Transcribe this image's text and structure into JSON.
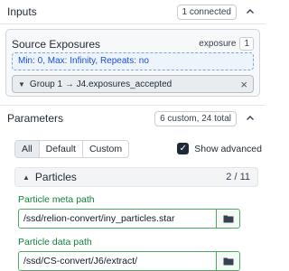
{
  "inputs": {
    "title": "Inputs",
    "badge": "1 connected",
    "source": {
      "title": "Source Exposures",
      "type_label": "exposure",
      "count": "1",
      "constraints": "Min: 0, Max: Infinity, Repeats: no",
      "connection": "Group 1 → J4.exposures_accepted"
    }
  },
  "parameters": {
    "title": "Parameters",
    "badge": "6 custom, 24 total",
    "tabs": [
      "All",
      "Default",
      "Custom"
    ],
    "show_advanced_label": "Show advanced",
    "show_advanced_checked": true,
    "group": {
      "title": "Particles",
      "count": "2 / 11"
    },
    "fields": [
      {
        "label": "Particle meta path",
        "value": "/ssd/relion-convert/iny_particles.star"
      },
      {
        "label": "Particle data path",
        "value": "/ssd/CS-convert/J6/extract/"
      }
    ]
  },
  "icons": {
    "chevron": "chevron-up-icon",
    "folder": "folder-icon",
    "close": "close-icon"
  },
  "colors": {
    "accent_green": "#15803d",
    "constraint_blue": "#1d4ed8"
  }
}
